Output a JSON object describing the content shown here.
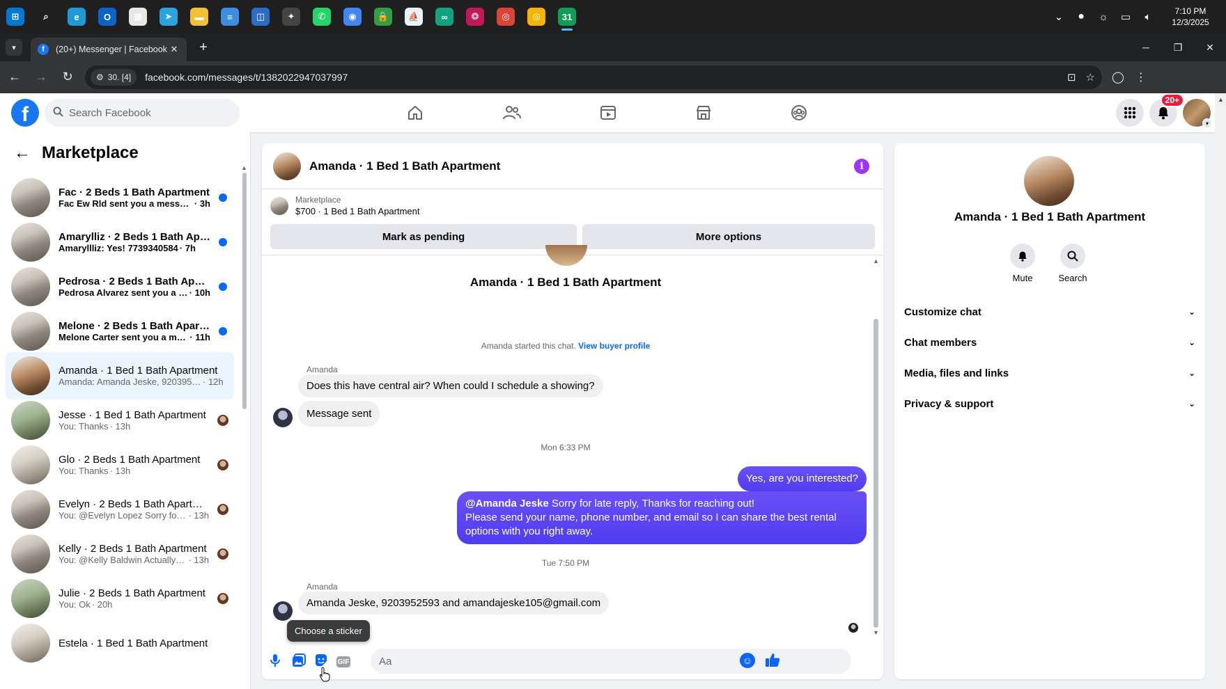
{
  "taskbar": {
    "clock_time": "7:10 PM",
    "clock_date": "12/3/2025",
    "apps": [
      {
        "name": "windows-start-icon",
        "glyph": "⊞",
        "color": "#0078d4"
      },
      {
        "name": "search-icon",
        "glyph": "⌕",
        "color": "#1f1f1f"
      },
      {
        "name": "edge-icon",
        "glyph": "e",
        "color": "#1d9bd7"
      },
      {
        "name": "outlook-icon",
        "glyph": "O",
        "color": "#0a64c8"
      },
      {
        "name": "store-icon",
        "glyph": "▦",
        "color": "#e7e7e7"
      },
      {
        "name": "telegram-icon",
        "glyph": "➤",
        "color": "#2aa3df"
      },
      {
        "name": "file-explorer-icon",
        "glyph": "▬",
        "color": "#f2c037"
      },
      {
        "name": "notepad-icon",
        "glyph": "≡",
        "color": "#3d8ee0"
      },
      {
        "name": "snipping-tool-icon",
        "glyph": "◫",
        "color": "#2b6cc4"
      },
      {
        "name": "inkscape-icon",
        "glyph": "✦",
        "color": "#444"
      },
      {
        "name": "whatsapp-icon",
        "glyph": "✆",
        "color": "#25d366"
      },
      {
        "name": "chrome-blue-icon",
        "glyph": "◉",
        "color": "#4285f4"
      },
      {
        "name": "vpn-lock-icon",
        "glyph": "🔒",
        "color": "#2f9e44"
      },
      {
        "name": "sail-icon",
        "glyph": "⛵",
        "color": "#e9f1fb"
      },
      {
        "name": "loop-icon",
        "glyph": "∞",
        "color": "#10a37f"
      },
      {
        "name": "color-wheel-icon",
        "glyph": "❂",
        "color": "#c2185b"
      },
      {
        "name": "chrome-profile-s-icon",
        "glyph": "◎",
        "color": "#db4437"
      },
      {
        "name": "chrome-profile-a-icon",
        "glyph": "◎",
        "color": "#f4b400"
      },
      {
        "name": "sheets-31-icon",
        "glyph": "31",
        "color": "#0f9d58"
      }
    ]
  },
  "browser": {
    "tab_title": "(20+) Messenger | Facebook",
    "url": "facebook.com/messages/t/1382022947037997",
    "site_chip": "30. [4]"
  },
  "fb": {
    "search_placeholder": "Search Facebook",
    "notif_badge": "20+"
  },
  "left": {
    "title": "Marketplace",
    "conversations": [
      {
        "name": "Fac · 2 Beds 1 Bath Apartment",
        "snippet": "Fac Ew Rld sent you a message ...",
        "time": "· 3h",
        "unread": true,
        "thumb": "apt"
      },
      {
        "name": "Amarylliz · 2 Beds 1 Bath Apart...",
        "snippet": "Amaryllliz: Yes! 7739340584",
        "time": "· 7h",
        "unread": true,
        "thumb": "apt"
      },
      {
        "name": "Pedrosa · 2 Beds 1 Bath Apart...",
        "snippet": "Pedrosa Alvarez sent you a me...",
        "time": "· 10h",
        "unread": true,
        "thumb": "apt"
      },
      {
        "name": "Melone · 2 Beds 1 Bath Apart...",
        "snippet": "Melone Carter sent you a mess...",
        "time": "· 11h",
        "unread": true,
        "thumb": "apt"
      },
      {
        "name": "Amanda · 1 Bed 1 Bath Apartment",
        "snippet": "Amanda: Amanda Jeske, 9203952...",
        "time": "· 12h",
        "unread": false,
        "thumb": "apt4",
        "selected": true
      },
      {
        "name": "Jesse · 1 Bed 1 Bath Apartment",
        "snippet": "You: Thanks",
        "time": "· 13h",
        "unread": false,
        "thumb": "apt3"
      },
      {
        "name": "Glo · 2 Beds 1 Bath Apartment",
        "snippet": "You: Thanks",
        "time": "· 13h",
        "unread": false,
        "thumb": "apt2"
      },
      {
        "name": "Evelyn · 2 Beds 1 Bath Apartment",
        "snippet": "You: @Evelyn Lopez Sorry for late ...",
        "time": "· 13h",
        "unread": false,
        "thumb": "apt"
      },
      {
        "name": "Kelly · 2 Beds 1 Bath Apartment",
        "snippet": "You: @Kelly Baldwin Actually i'...",
        "time": "· 13h",
        "unread": false,
        "thumb": "apt"
      },
      {
        "name": "Julie · 2 Beds 1 Bath Apartment",
        "snippet": "You: Ok",
        "time": "· 20h",
        "unread": false,
        "thumb": "apt3"
      },
      {
        "name": "Estela · 1 Bed 1 Bath Apartment",
        "snippet": "",
        "time": "",
        "unread": false,
        "thumb": "apt2"
      }
    ]
  },
  "chat": {
    "title": "Amanda · 1 Bed 1 Bath Apartment",
    "listing_source": "Marketplace",
    "listing_title": "$700 · 1 Bed 1 Bath Apartment",
    "btn_pending": "Mark as pending",
    "btn_more": "More options",
    "intro_name": "Amanda · 1 Bed 1 Bath Apartment",
    "started_text": "Amanda started this chat.",
    "view_profile": "View buyer profile",
    "sender1": "Amanda",
    "msg1": "Does this have central air? When could I schedule a showing?",
    "msg2": "Message sent",
    "time1": "Mon 6:33 PM",
    "out1": "Yes, are you interested?",
    "out2_mention": "@Amanda Jeske",
    "out2_line1": " Sorry for late reply, Thanks for reaching out!",
    "out2_line2": "Please send your name, phone number, and email so I can share the best rental options with you right away.",
    "time2": "Tue 7:50 PM",
    "sender2": "Amanda",
    "msg3": "Amanda Jeske, 9203952593 and amandajeske105@gmail.com",
    "tooltip": "Choose a sticker",
    "composer_placeholder": "Aa"
  },
  "right": {
    "name": "Amanda · 1 Bed 1 Bath Apartment",
    "mute": "Mute",
    "search": "Search",
    "rows": [
      "Customize chat",
      "Chat members",
      "Media, files and links",
      "Privacy & support"
    ]
  }
}
